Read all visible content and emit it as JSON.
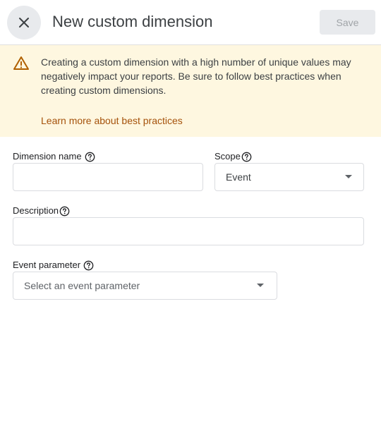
{
  "header": {
    "title": "New custom dimension",
    "save_label": "Save"
  },
  "warning": {
    "message": "Creating a custom dimension with a high number of unique values may negatively impact your reports. Be sure to follow best practices when creating custom dimensions.",
    "link": "Learn more about best practices"
  },
  "form": {
    "dimension_name": {
      "label": "Dimension name",
      "value": ""
    },
    "scope": {
      "label": "Scope",
      "selected": "Event"
    },
    "description": {
      "label": "Description",
      "value": ""
    },
    "event_parameter": {
      "label": "Event parameter",
      "placeholder": "Select an event parameter"
    }
  },
  "colors": {
    "warning_background": "#fef7e0",
    "warning_icon": "#b06000",
    "link": "#a5520b",
    "disabled_button": "#e8eaed"
  },
  "icons": {
    "close": "close-icon",
    "warning": "warning-icon",
    "help": "help-icon",
    "dropdown": "chevron-down-icon"
  }
}
